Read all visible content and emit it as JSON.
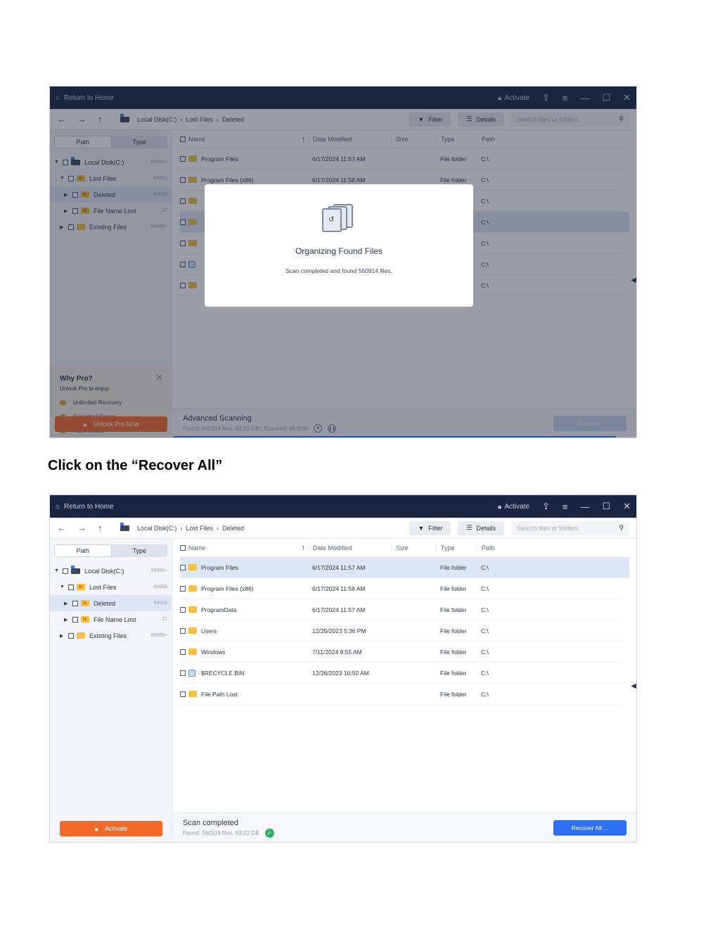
{
  "window": {
    "return_home": "Return to Home",
    "activate": "Activate",
    "search_placeholder": "Search files or folders",
    "filter": "Filter",
    "details": "Details",
    "breadcrumb": [
      "Local Disk(C:)",
      "Lost Files",
      "Deleted"
    ]
  },
  "sidebar": {
    "tab_path": "Path",
    "tab_type": "Type"
  },
  "columns": {
    "name": "Name",
    "date": "Date Modified",
    "size": "Size",
    "type": "Type",
    "path": "Path"
  },
  "shot1": {
    "tree": [
      {
        "label": "Local Disk(C:)",
        "count": "99999+"
      },
      {
        "label": "Lost Files",
        "count": "64051"
      },
      {
        "label": "Deleted",
        "count": "64034"
      },
      {
        "label": "File Name Lost",
        "count": "17"
      },
      {
        "label": "Existing Files",
        "count": "99999+"
      }
    ],
    "rows": [
      {
        "name": "Program Files",
        "date": "6/17/2024 11:57 AM",
        "type": "File folder",
        "path": "C:\\"
      },
      {
        "name": "Program Files (x86)",
        "date": "6/17/2024 11:58 AM",
        "type": "File folder",
        "path": "C:\\"
      },
      {
        "name": "",
        "date": "",
        "type": "",
        "path": "C:\\"
      },
      {
        "name": "",
        "date": "",
        "type": "",
        "path": "C:\\"
      },
      {
        "name": "",
        "date": "",
        "type": "",
        "path": "C:\\"
      },
      {
        "name": "",
        "date": "",
        "type": "",
        "path": "C:\\"
      },
      {
        "name": "",
        "date": "",
        "type": "",
        "path": "C:\\"
      }
    ],
    "promo": {
      "title": "Why Pro?",
      "subtitle": "Unlock Pro to enjoy:",
      "features": [
        "Unlimited Recovery",
        "Corrupted Repair",
        "Full Preview"
      ],
      "button": "Unlock Pro Now"
    },
    "footer": {
      "title": "Advanced Scanning",
      "status": "Found: 560914 files, 63.03 GB  |  Scanned: 96.80%",
      "recover": "Recover"
    },
    "modal": {
      "title": "Organizing Found Files",
      "message": "Scan completed and found 560914 files."
    }
  },
  "caption": "Click on the “Recover All”",
  "shot2": {
    "tree": [
      {
        "label": "Local Disk(C:)",
        "count": "99999+"
      },
      {
        "label": "Lost Files",
        "count": "64055"
      },
      {
        "label": "Deleted",
        "count": "64034"
      },
      {
        "label": "File Name Lost",
        "count": "21"
      },
      {
        "label": "Existing Files",
        "count": "99999+"
      }
    ],
    "rows": [
      {
        "name": "Program Files",
        "date": "6/17/2024 11:57 AM",
        "type": "File folder",
        "path": "C:\\"
      },
      {
        "name": "Program Files (x86)",
        "date": "6/17/2024 11:58 AM",
        "type": "File folder",
        "path": "C:\\"
      },
      {
        "name": "ProgramData",
        "date": "6/17/2024 11:57 AM",
        "type": "File folder",
        "path": "C:\\"
      },
      {
        "name": "Users",
        "date": "12/25/2023 5:36 PM",
        "type": "File folder",
        "path": "C:\\"
      },
      {
        "name": "Windows",
        "date": "7/11/2024 9:55 AM",
        "type": "File folder",
        "path": "C:\\"
      },
      {
        "name": "$RECYCLE.BIN",
        "date": "12/26/2023 10:50 AM",
        "type": "File folder",
        "path": "C:\\"
      },
      {
        "name": "File Path Lost",
        "date": "",
        "type": "File folder",
        "path": "C:\\"
      }
    ],
    "activate_button": "Activate",
    "footer": {
      "title": "Scan completed",
      "status": "Found: 560918 files, 63.03 GB",
      "recover": "Recover All ..."
    }
  }
}
